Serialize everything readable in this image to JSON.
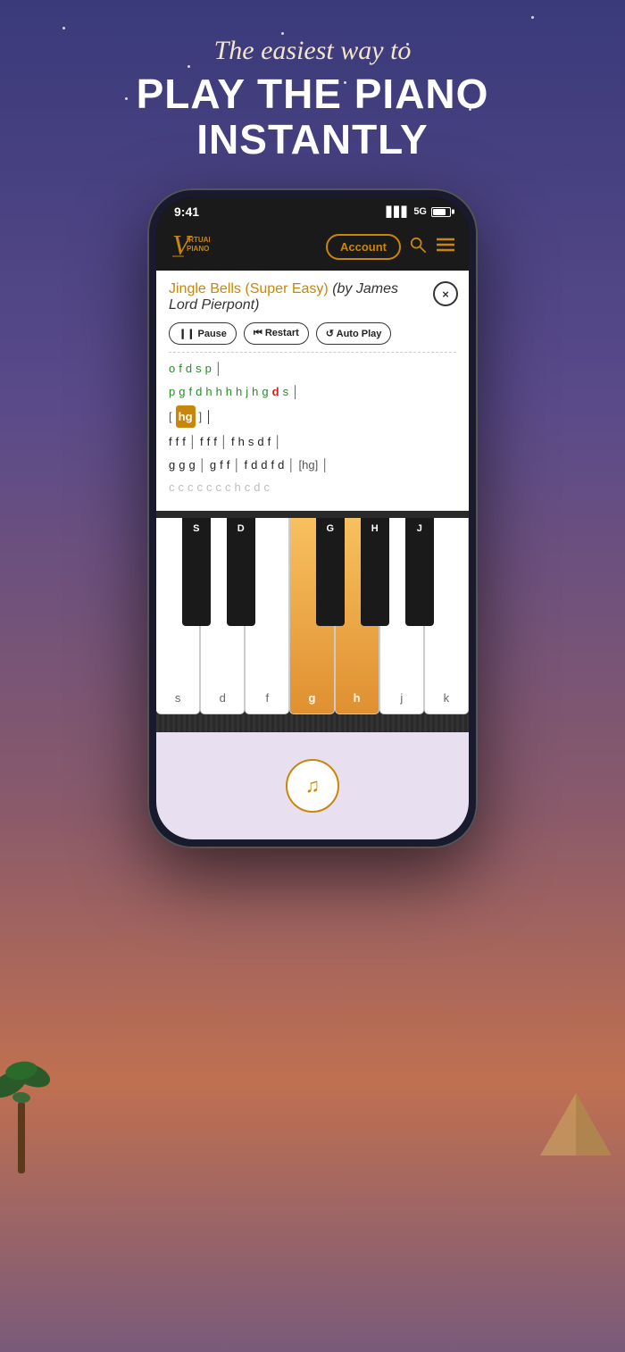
{
  "background": {
    "gradient_start": "#3a3a7a",
    "gradient_end": "#c07050"
  },
  "header": {
    "subtitle": "The easiest way to",
    "title_line1": "PLAY THE PIANO",
    "title_line2": "INSTANTLY"
  },
  "status_bar": {
    "time": "9:41",
    "signal": "●●●",
    "network": "5G"
  },
  "nav": {
    "logo_text_line1": "IRTUAL",
    "logo_text_line2": "PIANO",
    "account_btn": "Account",
    "search_icon": "search",
    "menu_icon": "menu"
  },
  "song": {
    "title_orange": "Jingle Bells (Super Easy)",
    "title_italic": "(by James Lord Pierpont)",
    "close_label": "×"
  },
  "controls": {
    "pause_label": "❙❙ Pause",
    "restart_label": "⏮ Restart",
    "autoplay_label": "↺ Auto Play"
  },
  "sheet_music": {
    "line1": [
      "o",
      "f",
      "d",
      "s",
      "p",
      "│"
    ],
    "line2_green": [
      "p",
      "g",
      "f",
      "d",
      "h",
      "h",
      "h",
      "h",
      "j",
      "h",
      "g"
    ],
    "line2_red": "d",
    "line2_end": [
      "s",
      "│"
    ],
    "line3_bracket_highlight": "hg",
    "line4": [
      "f",
      "f",
      "f",
      "│",
      "f",
      "f",
      "f",
      "│",
      "f",
      "h",
      "s",
      "d",
      "f",
      "│"
    ],
    "line5": [
      "g",
      "g",
      "g",
      "│",
      "g",
      "f",
      "f",
      "│",
      "f",
      "d",
      "d",
      "f",
      "d",
      "│",
      "[hg]",
      "│"
    ]
  },
  "piano": {
    "white_keys": [
      {
        "label": "s",
        "active": false
      },
      {
        "label": "d",
        "active": false
      },
      {
        "label": "f",
        "active": false
      },
      {
        "label": "g",
        "active": true
      },
      {
        "label": "h",
        "active": true
      },
      {
        "label": "j",
        "active": false
      },
      {
        "label": "k",
        "active": false
      }
    ],
    "black_keys_upper": [
      "S",
      "D",
      "",
      "G",
      "H",
      "",
      "J"
    ],
    "highlight_color": "#e8a030"
  },
  "bottom": {
    "music_note_icon": "♫"
  }
}
